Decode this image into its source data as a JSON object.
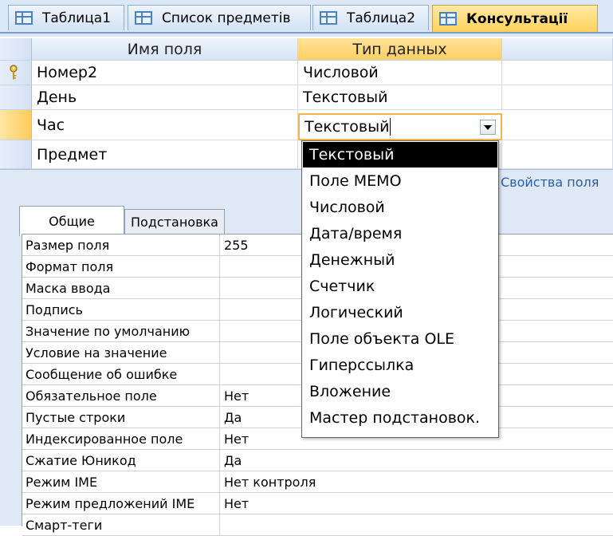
{
  "tabs": [
    {
      "label": "Таблица1"
    },
    {
      "label": "Список предметів"
    },
    {
      "label": "Таблица2"
    },
    {
      "label": "Консультації"
    }
  ],
  "grid": {
    "field_name_header": "Имя поля",
    "data_type_header": "Тип данных",
    "rows": [
      {
        "name": "Номер2",
        "type": "Числовой",
        "primary_key": true
      },
      {
        "name": "День",
        "type": "Текстовый"
      },
      {
        "name": "Час",
        "type": "Текстовый",
        "current": true
      },
      {
        "name": "Предмет",
        "type": ""
      }
    ]
  },
  "properties": {
    "band_label": "Свойства поля",
    "tabs": [
      "Общие",
      "Подстановка"
    ],
    "rows": [
      {
        "label": "Размер поля",
        "value": "255"
      },
      {
        "label": "Формат поля",
        "value": ""
      },
      {
        "label": "Маска ввода",
        "value": ""
      },
      {
        "label": "Подпись",
        "value": ""
      },
      {
        "label": "Значение по умолчанию",
        "value": ""
      },
      {
        "label": "Условие на значение",
        "value": ""
      },
      {
        "label": "Сообщение об ошибке",
        "value": ""
      },
      {
        "label": "Обязательное поле",
        "value": "Нет"
      },
      {
        "label": "Пустые строки",
        "value": "Да"
      },
      {
        "label": "Индексированное поле",
        "value": "Нет"
      },
      {
        "label": "Сжатие Юникод",
        "value": "Да"
      },
      {
        "label": "Режим IME",
        "value": "Нет контроля"
      },
      {
        "label": "Режим предложений IME",
        "value": "Нет"
      },
      {
        "label": "Смарт-теги",
        "value": ""
      }
    ]
  },
  "data_type_dropdown": {
    "current_value": "Текстовый",
    "selected_index": 0,
    "options": [
      "Текстовый",
      "Поле МЕМО",
      "Числовой",
      "Дата/время",
      "Денежный",
      "Счетчик",
      "Логический",
      "Поле объекта OLE",
      "Гиперссылка",
      "Вложение",
      "Мастер подстановок."
    ]
  },
  "colors": {
    "active_tab": "#ffd25a",
    "selection": "#000000",
    "combo_border": "#f3b54b",
    "band": "#dfe9f6"
  }
}
